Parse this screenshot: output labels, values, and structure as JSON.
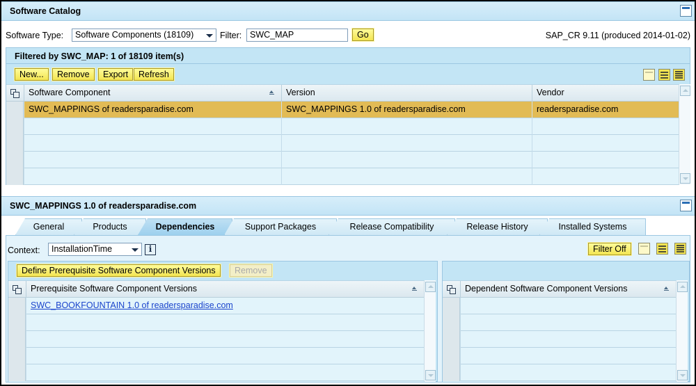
{
  "catalog": {
    "title": "Software Catalog",
    "software_type_label": "Software Type:",
    "software_type_value": "Software Components (18109)",
    "filter_label": "Filter:",
    "filter_value": "SWC_MAP",
    "go_label": "Go",
    "version_info": "SAP_CR 9.11 (produced 2014-01-02)",
    "filtered_title": "Filtered by SWC_MAP: 1 of 18109 item(s)",
    "toolbar": {
      "new_label": "New...",
      "remove_label": "Remove",
      "export_label": "Export",
      "refresh_label": "Refresh"
    },
    "table": {
      "columns": [
        "Software Component",
        "Version",
        "Vendor"
      ],
      "rows": [
        [
          "SWC_MAPPINGS of readersparadise.com",
          "SWC_MAPPINGS 1.0 of readersparadise.com",
          "readersparadise.com"
        ],
        [
          "",
          "",
          ""
        ],
        [
          "",
          "",
          ""
        ],
        [
          "",
          "",
          ""
        ],
        [
          "",
          "",
          ""
        ]
      ],
      "selected_row": 0
    }
  },
  "detail": {
    "title": "SWC_MAPPINGS 1.0 of readersparadise.com",
    "tabs": [
      "General",
      "Products",
      "Dependencies",
      "Support Packages",
      "Release Compatibility",
      "Release History",
      "Installed Systems"
    ],
    "active_tab": "Dependencies",
    "context_label": "Context:",
    "context_value": "InstallationTime",
    "filter_off_label": "Filter Off",
    "define_label": "Define Prerequisite Software Component Versions",
    "remove_label": "Remove",
    "prereq_table": {
      "column": "Prerequisite Software Component Versions",
      "rows": [
        "SWC_BOOKFOUNTAIN 1.0 of readersparadise.com",
        "",
        "",
        "",
        ""
      ]
    },
    "dependent_table": {
      "column": "Dependent Software Component Versions",
      "rows": [
        "",
        "",
        "",
        "",
        ""
      ]
    }
  },
  "colors": {
    "panel_header": "#c3e4f6",
    "button_yellow": "#f3e552",
    "selected_row": "#e2bb55",
    "grid_bg": "#e2f4fb",
    "link": "#1a44cc"
  }
}
